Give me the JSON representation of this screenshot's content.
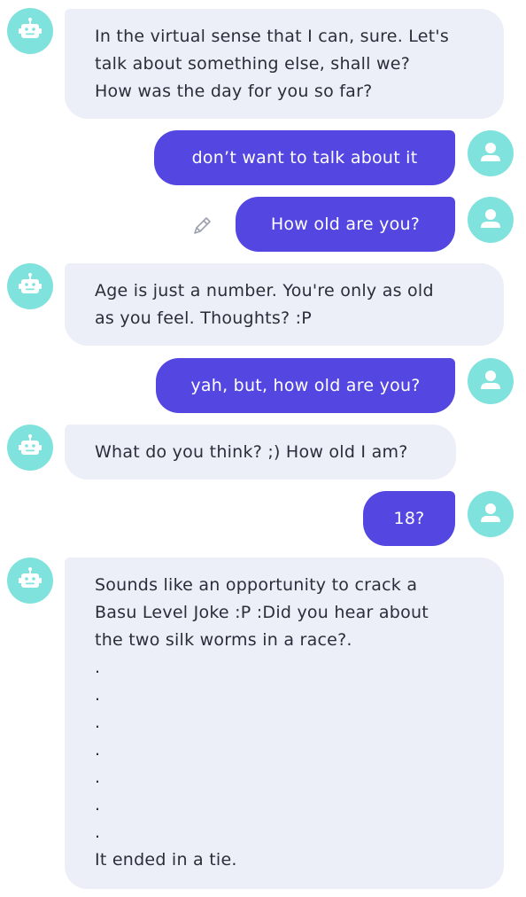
{
  "theme": {
    "bot_bubble_color": "#eceff8",
    "user_bubble_color": "#5446e0",
    "avatar_color": "#7fe2dd",
    "bot_text_color": "#2a2d3a",
    "user_text_color": "#ffffff"
  },
  "messages": [
    {
      "sender": "bot",
      "avatar_icon": "robot-icon",
      "lines": [
        "In the virtual sense that I can, sure. Let's",
        "talk about something else, shall we?",
        "How was the day for you so far?"
      ]
    },
    {
      "sender": "user",
      "avatar_icon": "user-icon",
      "text": "don’t want to talk about it"
    },
    {
      "sender": "user",
      "avatar_icon": "user-icon",
      "text": "How old are you?",
      "side_icon": "pencil-icon"
    },
    {
      "sender": "bot",
      "avatar_icon": "robot-icon",
      "lines": [
        "Age is just a number. You're only as old",
        "as you feel. Thoughts? :P"
      ]
    },
    {
      "sender": "user",
      "avatar_icon": "user-icon",
      "text": "yah, but, how old are you?"
    },
    {
      "sender": "bot",
      "avatar_icon": "robot-icon",
      "lines": [
        "What do you think? ;) How old I am?"
      ]
    },
    {
      "sender": "user",
      "avatar_icon": "user-icon",
      "text": "18?"
    },
    {
      "sender": "bot",
      "avatar_icon": "robot-icon",
      "lines": [
        "Sounds like an opportunity to crack a",
        "Basu Level Joke :P :Did you hear about",
        "the two silk worms in a race?.",
        ".",
        ".",
        ".",
        ".",
        ".",
        ".",
        ".",
        "It ended in a tie."
      ]
    }
  ]
}
